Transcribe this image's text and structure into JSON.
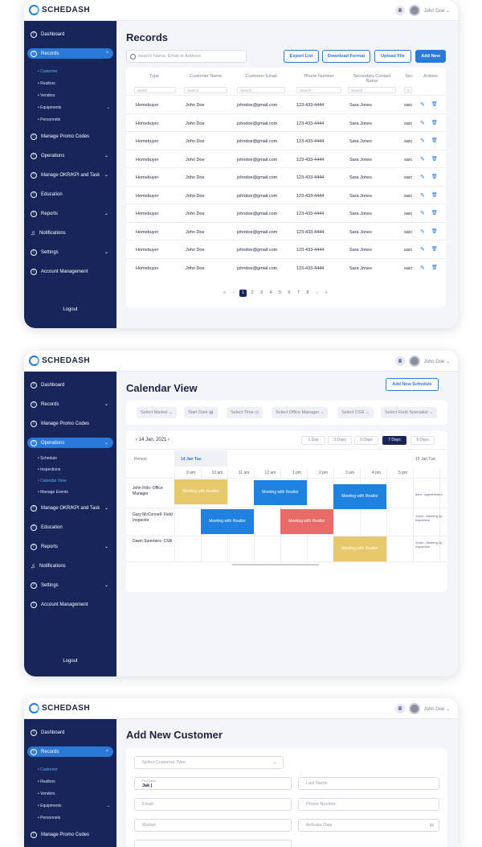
{
  "app": {
    "logo": "SCHEDASH",
    "user": "John Doe ⌄"
  },
  "screen1": {
    "title": "Records",
    "search_placeholder": "Search Name, Email or Address",
    "buttons": [
      "Export List",
      "Download Format",
      "Upload File",
      "Add New"
    ],
    "sidebar": {
      "items": [
        "Dashboard",
        "Records",
        "Manage Promo Codes",
        "Operations",
        "Manage OKR/KPI and Task",
        "Education",
        "Reports",
        "Notifications",
        "Settings",
        "Account Management"
      ],
      "subitems": [
        "Customer",
        "Realtors",
        "Vendors",
        "Equipments",
        "Personnels"
      ],
      "logout": "Logout"
    },
    "columns": [
      "Type",
      "Customer Name",
      "Customer Email",
      "Phone Number",
      "Secondary Contact Name",
      "Sec",
      "Actions"
    ],
    "filters": [
      "Select",
      "Search",
      "Search",
      "Search",
      "Search",
      "S"
    ],
    "row": {
      "type": "Homebuyer",
      "name": "John Doe",
      "email": "johndoe@gmail.com",
      "phone": "123-433-4444",
      "secondary": "Sara Jones",
      "sec": "sarc"
    },
    "pagination": [
      "«",
      "‹",
      "1",
      "2",
      "3",
      "4",
      "5",
      "6",
      "7",
      "8",
      "›",
      "»"
    ]
  },
  "screen2": {
    "title": "Calendar View",
    "add_button": "Add New Schedule",
    "sidebar": {
      "items": [
        "Dashboard",
        "Records",
        "Manage Promo Codes",
        "Operations",
        "Manage OKR/KPI and Task",
        "Education",
        "Reports",
        "Notifications",
        "Settings",
        "Account Management"
      ],
      "subitems": [
        "Schedule",
        "Inspections",
        "Calendar View",
        "Manage Events"
      ],
      "logout": "Logout"
    },
    "filters": [
      "Select Market ⌄",
      "Start Date ▤",
      "Select Time ◷",
      "Select Office Manager ⌄",
      "Select CSR ⌄",
      "Select Field Specialist ⌄"
    ],
    "date_nav": "‹  14 Jan, 2021  ›",
    "range_buttons": [
      "1 Day",
      "3 Days",
      "5 Days",
      "7 Days",
      "9 Days"
    ],
    "person_header": "Person",
    "day1": "14 Jan Tue",
    "day2": "15 Jan Tue",
    "times": [
      "9 am",
      "10 am",
      "11 am",
      "12 am",
      "1 pm",
      "2 pm",
      "3 pm",
      "4 pm",
      "5 pm"
    ],
    "people": [
      "John Fitts- Office Manager",
      "Gary McConnell- Field Inspector",
      "Dawn Summers- CSR"
    ],
    "event_label": "Meeting with Realtor",
    "day2_notes": [
      "8am - Appointment",
      "10am - Meeting 2p - Inspection",
      "10am - Meeting 2p - Inspection"
    ],
    "colors": {
      "yellow": "#e7c86a",
      "blue": "#1f82e0",
      "red": "#e86b68"
    }
  },
  "screen3": {
    "title": "Add New Customer",
    "customer_type": "Select Customer Type",
    "first_name_label": "First Name",
    "first_name_value": "Jak |",
    "fields": [
      "Last Name",
      "Email",
      "Phone Number",
      "Market",
      "Activate Date"
    ],
    "sidebar": {
      "items": [
        "Dashboard",
        "Records",
        "Manage Promo Codes"
      ],
      "subitems": [
        "Customer",
        "Realtors",
        "Vendors",
        "Equipments",
        "Personnels"
      ]
    }
  }
}
